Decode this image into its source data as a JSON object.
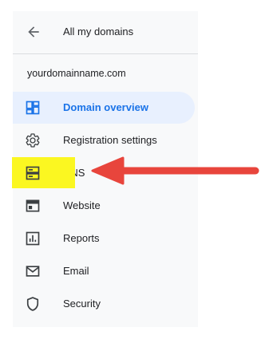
{
  "back": {
    "icon": "arrow-back-icon",
    "label": "All my domains"
  },
  "domain": {
    "name": "yourdomainname.com"
  },
  "nav": {
    "items": [
      {
        "label": "Domain overview",
        "icon": "dashboard-icon",
        "active": true
      },
      {
        "label": "Registration settings",
        "icon": "gear-icon",
        "active": false
      },
      {
        "label": "DNS",
        "icon": "dns-icon",
        "active": false,
        "highlighted": true
      },
      {
        "label": "Website",
        "icon": "web-icon",
        "active": false
      },
      {
        "label": "Reports",
        "icon": "bar-chart-icon",
        "active": false
      },
      {
        "label": "Email",
        "icon": "mail-icon",
        "active": false
      },
      {
        "label": "Security",
        "icon": "shield-icon",
        "active": false
      }
    ]
  },
  "colors": {
    "active_text": "#1a73e8",
    "active_bg": "#e8f0fe",
    "highlight": "#fbf721",
    "arrow": "#e8453c",
    "panel_bg": "#f8f9fa"
  }
}
